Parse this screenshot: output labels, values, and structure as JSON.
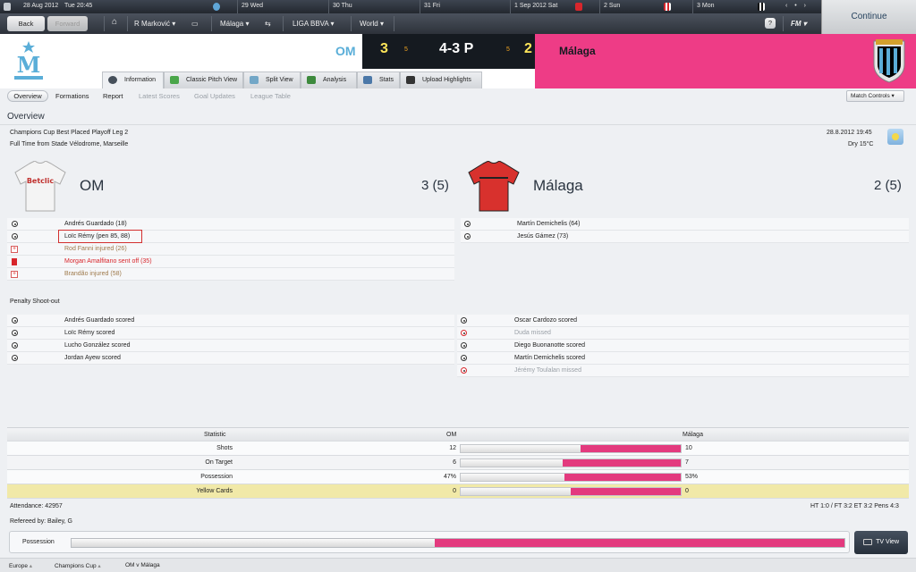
{
  "datebar": {
    "current": "28 Aug 2012",
    "current_time": "Tue 20:45",
    "days": [
      {
        "day": "29",
        "name": "Wed"
      },
      {
        "day": "30",
        "name": "Thu"
      },
      {
        "day": "31",
        "name": "Fri"
      },
      {
        "day": "1 Sep 2012",
        "name": "Sat"
      },
      {
        "day": "2",
        "name": "Sun"
      },
      {
        "day": "3",
        "name": "Mon"
      }
    ]
  },
  "nav": {
    "back": "Back",
    "forward": "Forward",
    "manager": "R Marković",
    "club": "Málaga",
    "league": "LIGA BBVA",
    "world": "World",
    "help": "?",
    "fm": "FM",
    "continue": "Continue"
  },
  "match": {
    "home": "OM",
    "away": "Málaga",
    "home_goals": "3",
    "away_goals": "2",
    "home_pens": "5",
    "away_pens": "5",
    "agg": "4-3 P",
    "home_score_line": "3 (5)",
    "away_score_line": "2 (5)"
  },
  "tabs": [
    "Information",
    "Classic Pitch View",
    "Split View",
    "Analysis",
    "Stats",
    "Upload Highlights"
  ],
  "subtabs": {
    "overview": "Overview",
    "formations": "Formations",
    "report": "Report",
    "latest_scores": "Latest Scores",
    "goal_updates": "Goal Updates",
    "league_table": "League Table",
    "match_controls": "Match Controls"
  },
  "overview": {
    "heading": "Overview",
    "competition": "Champions Cup Best Placed Playoff Leg 2",
    "result_line": "Full Time from Stade Vélodrome, Marseille",
    "datetime": "28.8.2012 19:45",
    "weather": "Dry 15°C"
  },
  "home_events": [
    "Andrés Guardado (18)",
    "Loïc Rémy (pen 85, 88)",
    "Rod Fanni injured (26)",
    "Morgan Amalfitano sent off (35)",
    "Brandão injured (58)"
  ],
  "away_events": [
    "Martín Demichelis (64)",
    "Jesús Gámez (73)"
  ],
  "shootout": {
    "title": "Penalty Shoot-out",
    "home": [
      "Andrés Guardado scored",
      "Loïc Rémy scored",
      "Lucho González scored",
      "Jordan Ayew scored"
    ],
    "away": [
      "Oscar Cardozo scored",
      "Duda missed",
      "Diego Buonanotte scored",
      "Martín Demichelis scored",
      "Jérémy Toulalan missed"
    ]
  },
  "stats": {
    "headers": [
      "Statistic",
      "OM",
      "Málaga"
    ],
    "rows": [
      {
        "label": "Shots",
        "home": "12",
        "away": "10",
        "home_v": 12,
        "away_v": 10
      },
      {
        "label": "On Target",
        "home": "6",
        "away": "7",
        "home_v": 6,
        "away_v": 7
      },
      {
        "label": "Possession",
        "home": "47%",
        "away": "53%",
        "home_v": 47,
        "away_v": 53
      },
      {
        "label": "Yellow Cards",
        "home": "0",
        "away": "0",
        "home_v": 0,
        "away_v": 0
      }
    ]
  },
  "info": {
    "attendance": "Attendance: 42957",
    "referee": "Refereed by: Bailey, G",
    "summary": "HT 1:0 / FT 3:2 ET 3:2 Pens 4:3"
  },
  "possession_bar": {
    "label": "Possession",
    "home_pct": 47,
    "away_pct": 53
  },
  "tv_view": "TV View",
  "footer": [
    "Europe",
    "Champions Cup",
    "OM v Málaga"
  ],
  "colors": {
    "accent": "#ee3c86",
    "score": "#ffe65a",
    "dark": "#151a20"
  }
}
